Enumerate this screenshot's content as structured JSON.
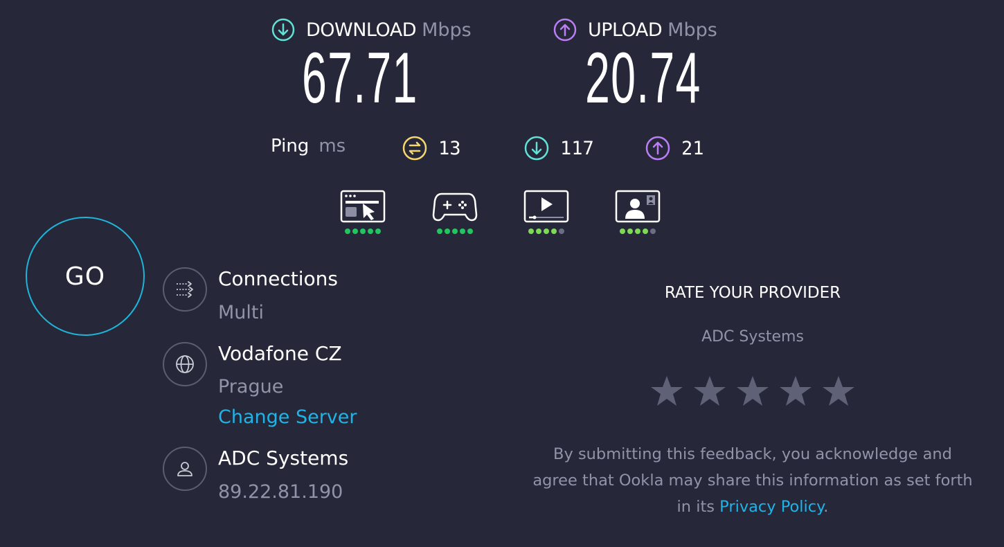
{
  "results": {
    "download": {
      "label": "DOWNLOAD",
      "unit": "Mbps",
      "value": "67.71",
      "color": "#62e1d6"
    },
    "upload": {
      "label": "UPLOAD",
      "unit": "Mbps",
      "value": "20.74",
      "color": "#bb7ef5"
    }
  },
  "ping": {
    "label": "Ping",
    "unit": "ms",
    "idle": {
      "icon": "ping-idle-icon",
      "value": "13",
      "color": "#f5d76e"
    },
    "download": {
      "icon": "download-latency-icon",
      "value": "117",
      "color": "#62e1d6"
    },
    "upload": {
      "icon": "upload-latency-icon",
      "value": "21",
      "color": "#bb7ef5"
    }
  },
  "quality": [
    {
      "icon": "web-browsing-icon",
      "rating": 5,
      "max": 5
    },
    {
      "icon": "gaming-controller-icon",
      "rating": 5,
      "max": 5
    },
    {
      "icon": "video-streaming-icon",
      "rating": 4,
      "max": 5
    },
    {
      "icon": "video-call-icon",
      "rating": 4,
      "max": 5
    }
  ],
  "go_button": {
    "label": "GO",
    "color": "#1fb4d8"
  },
  "connections": {
    "title": "Connections",
    "value": "Multi",
    "icon": "connections-icon"
  },
  "server": {
    "title": "Vodafone CZ",
    "location": "Prague",
    "change_label": "Change Server",
    "icon": "globe-icon"
  },
  "provider": {
    "title": "ADC Systems",
    "ip": "89.22.81.190",
    "icon": "user-icon"
  },
  "rate": {
    "title": "RATE YOUR PROVIDER",
    "provider_name": "ADC Systems",
    "stars_total": 5,
    "stars_selected": 0,
    "feedback_prefix": "By submitting this feedback, you acknowledge and agree that Ookla may share this information as set forth in its ",
    "privacy_link": "Privacy Policy",
    "feedback_suffix": "."
  },
  "colors": {
    "background": "#262839",
    "muted": "#9193a8",
    "link": "#1fb4e8",
    "dot_on": "#22c55e",
    "dot_off": "#6b6e82"
  }
}
